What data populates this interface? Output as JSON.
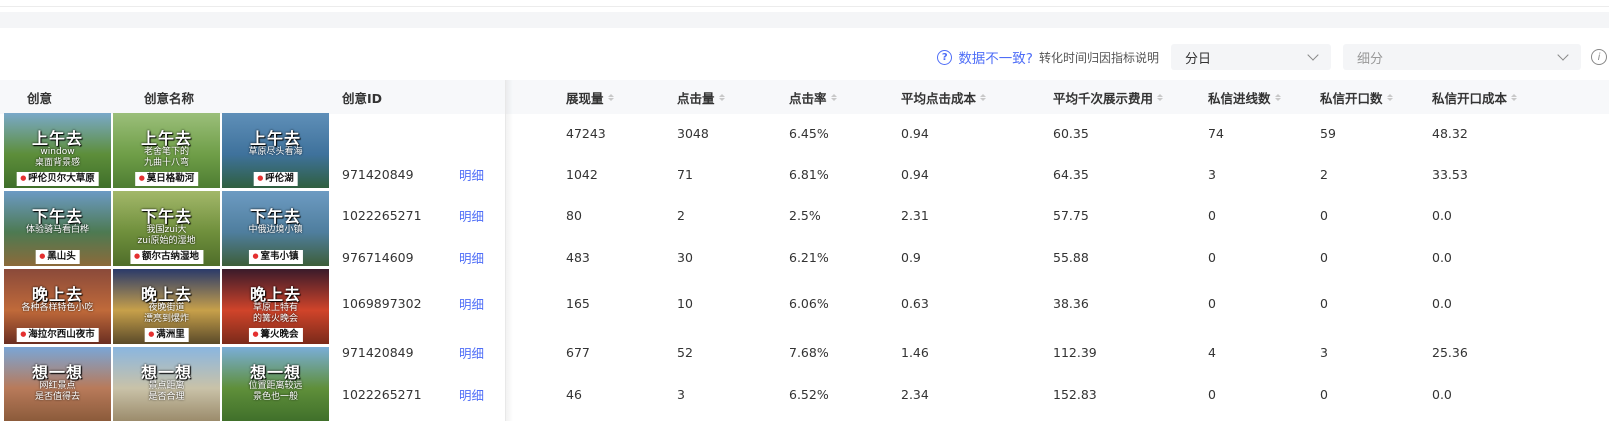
{
  "toolbar": {
    "data_mismatch_link": "数据不一致?",
    "attribution_note": "转化时间归因指标说明",
    "granularity_value": "分日",
    "breakdown_placeholder": "细分"
  },
  "table": {
    "headers": {
      "creative": "创意",
      "creative_name": "创意名称",
      "creative_id": "创意ID",
      "impressions": "展现量",
      "clicks": "点击量",
      "ctr": "点击率",
      "avg_cpc": "平均点击成本",
      "avg_cpm": "平均千次展示费用",
      "dm_leads": "私信进线数",
      "dm_opens": "私信开口数",
      "dm_open_cost": "私信开口成本"
    },
    "detail_label": "明细",
    "rows": [
      {
        "creative_id": "",
        "show_detail": false,
        "impressions": "47243",
        "clicks": "3048",
        "ctr": "6.45%",
        "avg_cpc": "0.94",
        "avg_cpm": "60.35",
        "dm_leads": "74",
        "dm_opens": "59",
        "dm_open_cost": "48.32"
      },
      {
        "creative_id": "971420849",
        "show_detail": true,
        "impressions": "1042",
        "clicks": "71",
        "ctr": "6.81%",
        "avg_cpc": "0.94",
        "avg_cpm": "64.35",
        "dm_leads": "3",
        "dm_opens": "2",
        "dm_open_cost": "33.53"
      },
      {
        "creative_id": "1022265271",
        "show_detail": true,
        "impressions": "80",
        "clicks": "2",
        "ctr": "2.5%",
        "avg_cpc": "2.31",
        "avg_cpm": "57.75",
        "dm_leads": "0",
        "dm_opens": "0",
        "dm_open_cost": "0.0"
      },
      {
        "creative_id": "976714609",
        "show_detail": true,
        "impressions": "483",
        "clicks": "30",
        "ctr": "6.21%",
        "avg_cpc": "0.9",
        "avg_cpm": "55.88",
        "dm_leads": "0",
        "dm_opens": "0",
        "dm_open_cost": "0.0"
      },
      {
        "creative_id": "1069897302",
        "show_detail": true,
        "impressions": "165",
        "clicks": "10",
        "ctr": "6.06%",
        "avg_cpc": "0.63",
        "avg_cpm": "38.36",
        "dm_leads": "0",
        "dm_opens": "0",
        "dm_open_cost": "0.0"
      },
      {
        "creative_id": "971420849",
        "show_detail": true,
        "impressions": "677",
        "clicks": "52",
        "ctr": "7.68%",
        "avg_cpc": "1.46",
        "avg_cpm": "112.39",
        "dm_leads": "4",
        "dm_opens": "3",
        "dm_open_cost": "25.36"
      },
      {
        "creative_id": "1022265271",
        "show_detail": true,
        "impressions": "46",
        "clicks": "3",
        "ctr": "6.52%",
        "avg_cpc": "2.34",
        "avg_cpm": "152.83",
        "dm_leads": "0",
        "dm_opens": "0",
        "dm_open_cost": "0.0"
      }
    ]
  },
  "thumbnails": [
    {
      "title": "上午去",
      "sub": "window\n桌面背景感",
      "tag": "呼伦贝尔大草原",
      "colors": [
        "#7aa9c9",
        "#5d8e3a",
        "#3f6f2a"
      ]
    },
    {
      "title": "上午去",
      "sub": "老舍笔下的\n九曲十八弯",
      "tag": "莫日格勒河",
      "colors": [
        "#9bbf7a",
        "#6f9e48",
        "#4e7d32"
      ]
    },
    {
      "title": "上午去",
      "sub": "草原尽头看海",
      "tag": "呼伦湖",
      "colors": [
        "#5f8fb8",
        "#3f729c",
        "#2f5f3f"
      ]
    },
    {
      "title": "下午去",
      "sub": "体验骑马看白桦",
      "tag": "黑山头",
      "colors": [
        "#6c9ac4",
        "#4d7a52",
        "#8c6a3a"
      ]
    },
    {
      "title": "下午去",
      "sub": "我国zui大\nzui原始的湿地",
      "tag": "额尔古纳湿地",
      "colors": [
        "#a3b86a",
        "#6f8f3c",
        "#4f6e2a"
      ]
    },
    {
      "title": "下午去",
      "sub": "中俄边境小镇",
      "tag": "室韦小镇",
      "colors": [
        "#6d9bc2",
        "#4f7e9e",
        "#3d5e38"
      ]
    },
    {
      "title": "晚上去",
      "sub": "各种各样特色小吃",
      "tag": "海拉尔西山夜市",
      "colors": [
        "#8a4a3a",
        "#c06a3a",
        "#6a2e22"
      ]
    },
    {
      "title": "晚上去",
      "sub": "夜晚街道\n漂亮到爆炸",
      "tag": "满洲里",
      "colors": [
        "#2a3a6a",
        "#c7a04a",
        "#5a4a2a"
      ]
    },
    {
      "title": "晚上去",
      "sub": "草原上特有\n的篝火晚会",
      "tag": "篝火晚会",
      "colors": [
        "#3a1a2a",
        "#d0442a",
        "#7a2a1a"
      ]
    },
    {
      "title": "想一想",
      "sub": "网红景点\n是否值得去",
      "tag": "",
      "colors": [
        "#7aa6d6",
        "#b87a5a",
        "#8a5a3a"
      ]
    },
    {
      "title": "想一想",
      "sub": "景点距离\n是否合理",
      "tag": "",
      "colors": [
        "#8ab6e0",
        "#c9c2a8",
        "#9a8a6a"
      ]
    },
    {
      "title": "想一想",
      "sub": "位置距离较远\n景色也一般",
      "tag": "",
      "colors": [
        "#7aaed8",
        "#5f8f3a",
        "#3f6f2a"
      ]
    }
  ]
}
